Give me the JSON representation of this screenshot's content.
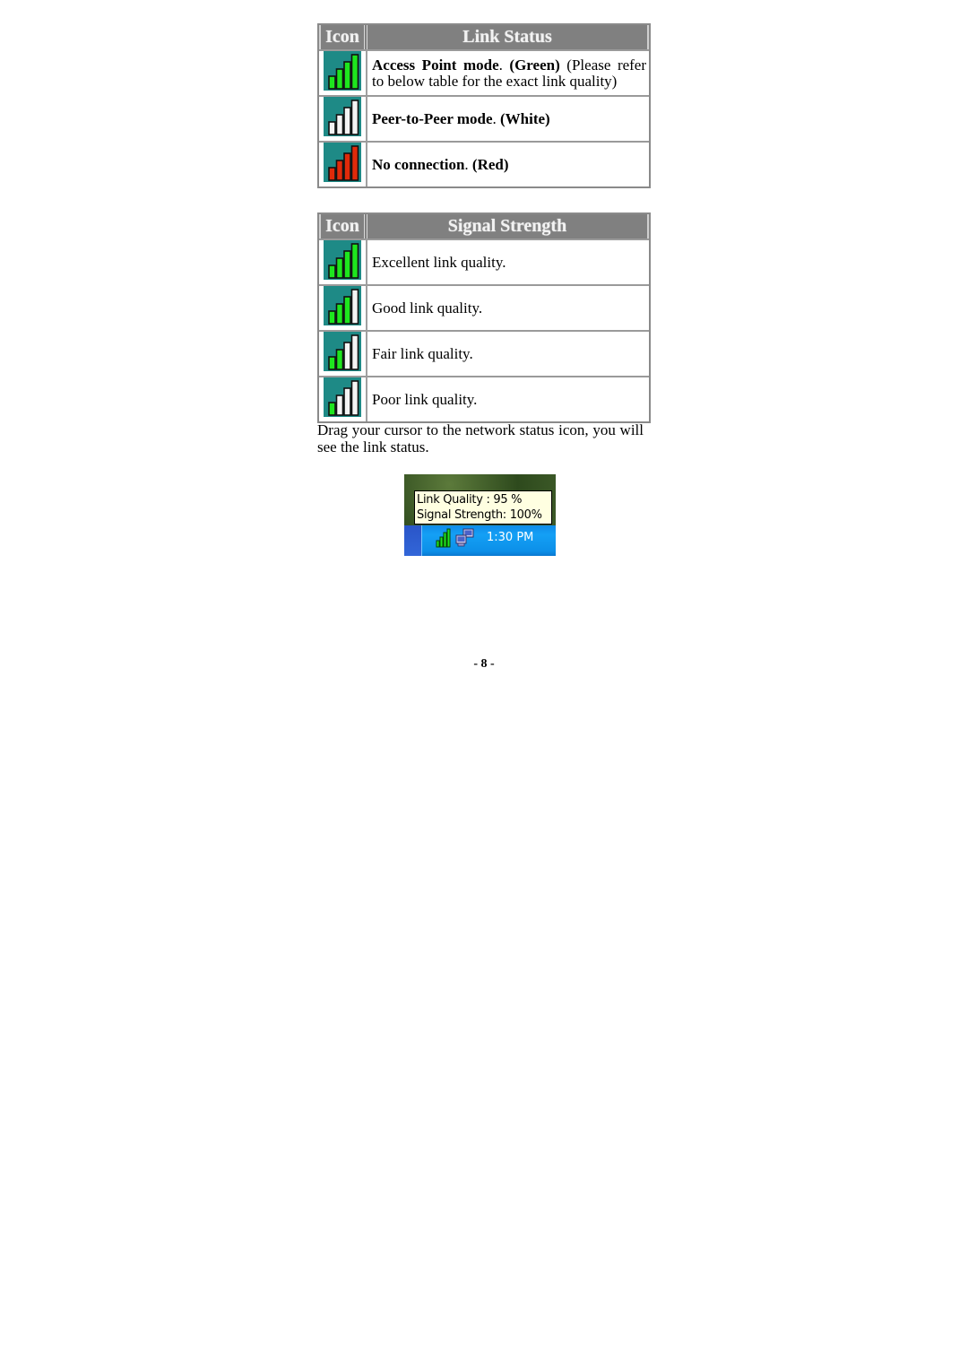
{
  "link_status_table": {
    "headers": {
      "icon": "Icon",
      "description": "Link Status"
    },
    "rows": [
      {
        "icon": "signal-green-icon",
        "bars": [
          "green",
          "green",
          "green",
          "green"
        ],
        "bold_text": "Access Point mode",
        "sep": ". ",
        "color_label": "(Green)",
        "note": " (Please refer to below table for the exact link quality)"
      },
      {
        "icon": "signal-white-icon",
        "bars": [
          "white",
          "white",
          "white",
          "white"
        ],
        "bold_text": "Peer-to-Peer mode",
        "sep": ". ",
        "color_label": "(White)",
        "note": ""
      },
      {
        "icon": "signal-red-icon",
        "bars": [
          "red",
          "red",
          "red",
          "red"
        ],
        "bold_text": "No connection",
        "sep": ". ",
        "color_label": "(Red)",
        "note": ""
      }
    ]
  },
  "signal_strength_table": {
    "headers": {
      "icon": "Icon",
      "description": "Signal Strength"
    },
    "rows": [
      {
        "icon": "signal-excellent-icon",
        "bars": [
          "green",
          "green",
          "green",
          "green"
        ],
        "text": "Excellent link quality."
      },
      {
        "icon": "signal-good-icon",
        "bars": [
          "green",
          "green",
          "green",
          "white"
        ],
        "text": "Good link quality."
      },
      {
        "icon": "signal-fair-icon",
        "bars": [
          "green",
          "green",
          "white",
          "white"
        ],
        "text": "Fair link quality."
      },
      {
        "icon": "signal-poor-icon",
        "bars": [
          "green",
          "white",
          "white",
          "white"
        ],
        "text": "Poor link quality."
      }
    ]
  },
  "instruction": "Drag your cursor to the network status icon, you will see the link status.",
  "tray_screenshot": {
    "tooltip_line1": "Link Quality : 95 %",
    "tooltip_line2": "Signal Strength: 100%",
    "clock": "1:30 PM"
  },
  "colors": {
    "icon_bg": "#1e8a86",
    "bar_green": "#1ee61e",
    "bar_white": "#f4f4f4",
    "bar_red": "#e02a0a",
    "header_bg": "#808080"
  },
  "page_number": "- 8 -"
}
